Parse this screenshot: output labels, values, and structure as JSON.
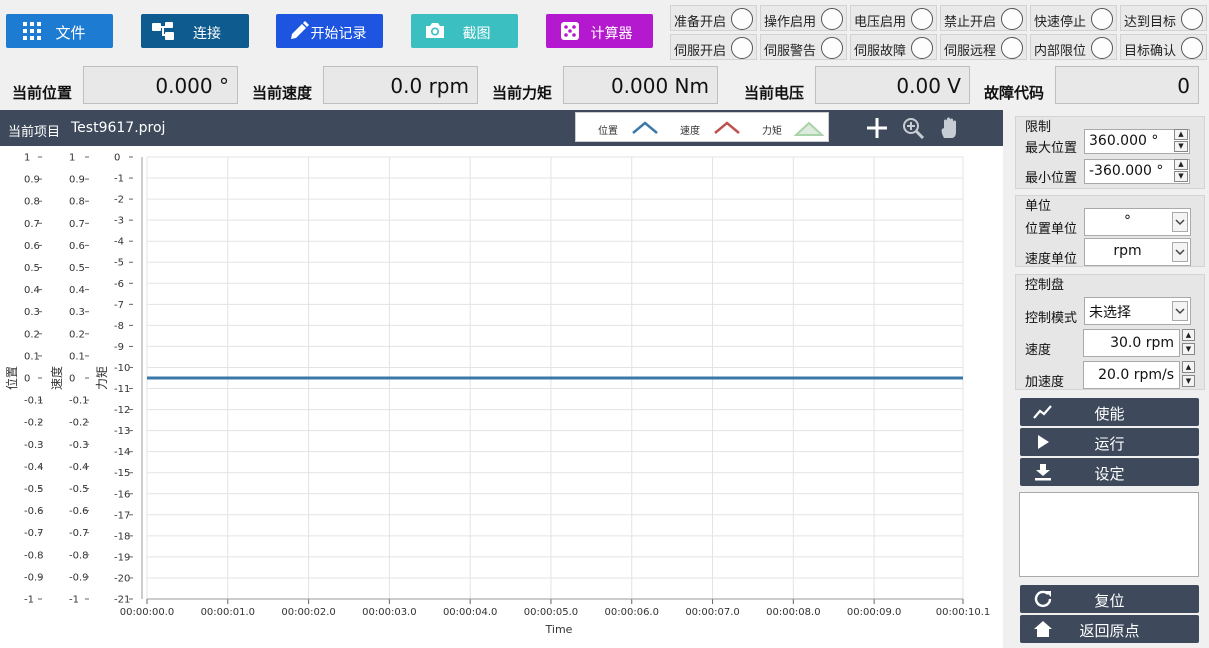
{
  "toolbar": {
    "file": "文件",
    "connect": "连接",
    "start_record": "开始记录",
    "screenshot": "截图",
    "calculator": "计算器",
    "colors": {
      "file": "#1e7bd2",
      "connect": "#0d5b8f",
      "start_record": "#1d55e0",
      "screenshot": "#3bbfc0",
      "calculator": "#b418cf"
    }
  },
  "indicators": [
    {
      "label": "准备开启",
      "icon": "led-off"
    },
    {
      "label": "操作启用",
      "icon": "led-off"
    },
    {
      "label": "电压启用",
      "icon": "led-off"
    },
    {
      "label": "禁止开启",
      "icon": "led-off"
    },
    {
      "label": "快速停止",
      "icon": "led-off"
    },
    {
      "label": "达到目标",
      "icon": "led-off"
    },
    {
      "label": "伺服开启",
      "icon": "led-off"
    },
    {
      "label": "伺服警告",
      "icon": "led-off"
    },
    {
      "label": "伺服故障",
      "icon": "led-off"
    },
    {
      "label": "伺服远程",
      "icon": "led-off"
    },
    {
      "label": "内部限位",
      "icon": "led-off"
    },
    {
      "label": "目标确认",
      "icon": "led-off"
    }
  ],
  "readouts": {
    "position": {
      "label": "当前位置",
      "value": "0.000 °"
    },
    "speed": {
      "label": "当前速度",
      "value": "0.0 rpm"
    },
    "torque": {
      "label": "当前力矩",
      "value": "0.000 Nm"
    },
    "voltage": {
      "label": "当前电压",
      "value": "0.00 V"
    },
    "fault": {
      "label": "故障代码",
      "value": "0"
    }
  },
  "chart_header": {
    "project_label": "当前项目",
    "project_name": "Test9617.proj",
    "legend": [
      {
        "name": "位置",
        "color": "#3a78a8"
      },
      {
        "name": "速度",
        "color": "#c0504d"
      },
      {
        "name": "力矩",
        "color": "#a9d3a9"
      }
    ],
    "tools": [
      "crosshair-icon",
      "zoom-icon",
      "pan-hand-icon"
    ]
  },
  "chart_data": {
    "type": "line",
    "xlabel": "Time",
    "x_ticks": [
      "00:00:00.0",
      "00:00:01.0",
      "00:00:02.0",
      "00:00:03.0",
      "00:00:04.0",
      "00:00:05.0",
      "00:00:06.0",
      "00:00:07.0",
      "00:00:08.0",
      "00:00:09.0",
      "00:00:10.1"
    ],
    "xlim": [
      0,
      10.1
    ],
    "grid": true,
    "axes": [
      {
        "label": "位置",
        "ylim": [
          -1,
          1
        ],
        "ticks": [
          "1",
          "0.9",
          "0.8",
          "0.7",
          "0.6",
          "0.5",
          "0.4",
          "0.3",
          "0.2",
          "0.1",
          "0",
          "-0.1",
          "-0.2",
          "-0.3",
          "-0.4",
          "-0.5",
          "-0.6",
          "-0.7",
          "-0.8",
          "-0.9",
          "-1"
        ]
      },
      {
        "label": "速度",
        "ylim": [
          -1,
          1
        ],
        "ticks": [
          "1",
          "0.9",
          "0.8",
          "0.7",
          "0.6",
          "0.5",
          "0.4",
          "0.3",
          "0.2",
          "0.1",
          "0",
          "-0.1",
          "-0.2",
          "-0.3",
          "-0.4",
          "-0.5",
          "-0.6",
          "-0.7",
          "-0.8",
          "-0.9",
          "-1"
        ]
      },
      {
        "label": "力矩",
        "ylim": [
          -21,
          0
        ],
        "ticks": [
          "0",
          "-1",
          "-2",
          "-3",
          "-4",
          "-5",
          "-6",
          "-7",
          "-8",
          "-9",
          "-10",
          "-11",
          "-12",
          "-13",
          "-14",
          "-15",
          "-16",
          "-17",
          "-18",
          "-19",
          "-20",
          "-21"
        ]
      }
    ],
    "series": [
      {
        "name": "位置",
        "axis": 0,
        "color": "#3a78a8",
        "x": [
          0,
          10.1
        ],
        "y": [
          0,
          0
        ]
      }
    ]
  },
  "panel": {
    "limits": {
      "title": "限制",
      "max_label": "最大位置",
      "max_value": "360.000 °",
      "min_label": "最小位置",
      "min_value": "-360.000 °"
    },
    "units": {
      "title": "单位",
      "pos_label": "位置单位",
      "pos_value": "°",
      "speed_label": "速度单位",
      "speed_value": "rpm"
    },
    "control": {
      "title": "控制盘",
      "mode_label": "控制模式",
      "mode_value": "未选择",
      "speed_label": "速度",
      "speed_value": "30.0 rpm",
      "accel_label": "加速度",
      "accel_value": "20.0 rpm/s"
    },
    "buttons": {
      "enable": "使能",
      "run": "运行",
      "set": "设定",
      "reset": "复位",
      "home": "返回原点"
    }
  }
}
